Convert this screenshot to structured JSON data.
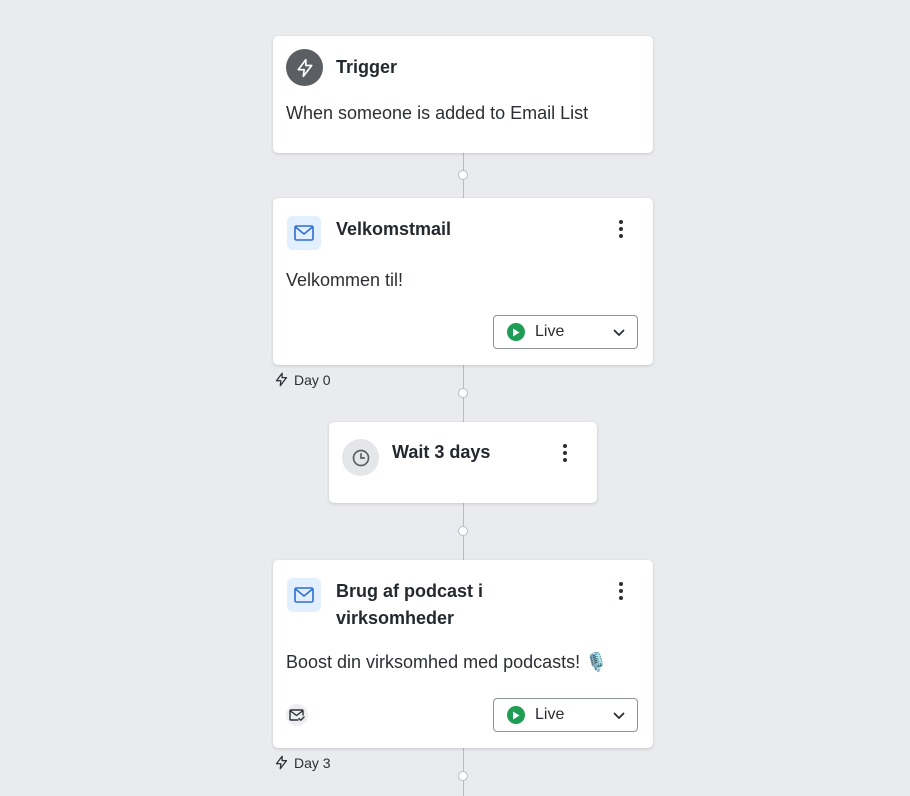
{
  "colors": {
    "canvas": "#e9ebee",
    "card": "#ffffff",
    "connector": "#b7bcc3",
    "live_green": "#1f9d55",
    "email_icon_bg": "#e2efff",
    "email_icon_fg": "#2f6fd0",
    "trigger_icon_bg": "#5b5e62"
  },
  "trigger": {
    "title": "Trigger",
    "description": "When someone is added to Email List",
    "icon": "lightning-icon"
  },
  "steps": [
    {
      "type": "email",
      "icon": "mail-icon",
      "title": "Velkomstmail",
      "preview": "Velkommen til!",
      "status": "Live",
      "day_label": "Day 0"
    },
    {
      "type": "wait",
      "icon": "clock-icon",
      "title": "Wait 3 days"
    },
    {
      "type": "email",
      "icon": "mail-icon",
      "title_line1": "Brug af podcast i",
      "title_line2": "virksomheder",
      "preview": "Boost din virksomhed med podcasts! 🎙️",
      "status": "Live",
      "footer_icon": "mail-check-icon",
      "day_label": "Day 3"
    }
  ]
}
